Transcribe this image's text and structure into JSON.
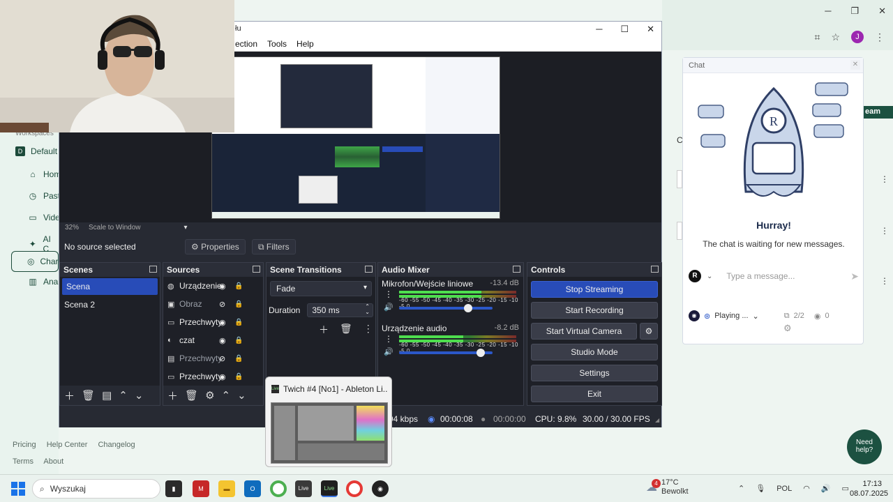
{
  "browser": {
    "sidebar": [
      {
        "label": "Default",
        "icon": "d-badge-icon"
      },
      {
        "label": "Hom",
        "icon": "home-icon"
      },
      {
        "label": "Past",
        "icon": "clock-icon"
      },
      {
        "label": "Vide",
        "icon": "video-icon"
      },
      {
        "label": "AI C",
        "icon": "sparkle-icon"
      },
      {
        "label": "Char",
        "icon": "channel-icon"
      },
      {
        "label": "Anal",
        "icon": "analytics-icon"
      }
    ],
    "workspace_label": "Workspaces",
    "bottom_links": [
      "Pricing",
      "Help Center",
      "Changelog",
      "Terms",
      "About"
    ],
    "help_button": "Need help?",
    "team_label": "eam",
    "partial_c": "C"
  },
  "chat": {
    "title": "Chat",
    "empty_title": "Hurray!",
    "empty_subtitle": "The chat is waiting for new messages.",
    "input_placeholder": "Type a message...",
    "badge": "R",
    "status": "Playing ...",
    "connections": "2/2",
    "viewers": "0"
  },
  "obs": {
    "title_fragment": "łu",
    "menu": [
      "ection",
      "Tools",
      "Help"
    ],
    "zoom": "32%",
    "scale_mode": "Scale to Window",
    "no_source": "No source selected",
    "properties_btn": "Properties",
    "filters_btn": "Filters",
    "scenes": {
      "title": "Scenes",
      "items": [
        "Scena",
        "Scena 2"
      ],
      "selected": "Scena"
    },
    "sources": {
      "title": "Sources",
      "items": [
        {
          "name": "Urządzenie",
          "visible": true,
          "icon": "speaker-icon"
        },
        {
          "name": "Obraz",
          "visible": false,
          "icon": "image-icon"
        },
        {
          "name": "Przechwyty",
          "visible": true,
          "icon": "monitor-icon"
        },
        {
          "name": "czat",
          "visible": true,
          "icon": "globe-icon"
        },
        {
          "name": "Przechwyty",
          "visible": false,
          "icon": "window-icon"
        },
        {
          "name": "Przechwyty",
          "visible": true,
          "icon": "monitor-icon"
        }
      ]
    },
    "transitions": {
      "title": "Scene Transitions",
      "selected": "Fade",
      "duration_label": "Duration",
      "duration_value": "350 ms"
    },
    "mixer": {
      "title": "Audio Mixer",
      "scale": "-60 -55 -50 -45 -40 -35 -30 -25 -20 -15 -10 -5 0",
      "channels": [
        {
          "name": "Mikrofon/Wejście liniowe",
          "db": "-13.4 dB",
          "level": 0.7,
          "volume": 0.74
        },
        {
          "name": "Urządzenie audio",
          "db": "-8.2 dB",
          "level": 0.55,
          "volume": 0.87
        }
      ]
    },
    "controls": {
      "title": "Controls",
      "stop_streaming": "Stop Streaming",
      "start_recording": "Start Recording",
      "start_virtual_camera": "Start Virtual Camera",
      "studio_mode": "Studio Mode",
      "settings": "Settings",
      "exit": "Exit"
    },
    "status": {
      "bitrate": "94 kbps",
      "stream_time": "00:00:08",
      "rec_time": "00:00:00",
      "cpu": "CPU: 9.8%",
      "fps": "30.00 / 30.00 FPS"
    }
  },
  "taskbar_preview": {
    "title": "Twich #4  [No1] - Ableton Li..."
  },
  "taskbar": {
    "search_placeholder": "Wyszukaj",
    "weather_temp": "17°C",
    "weather_desc": "Bewolkt",
    "weather_badge": "4",
    "language": "POL",
    "time": "17:13",
    "date": "08.07.2025",
    "live_label": "Live"
  }
}
